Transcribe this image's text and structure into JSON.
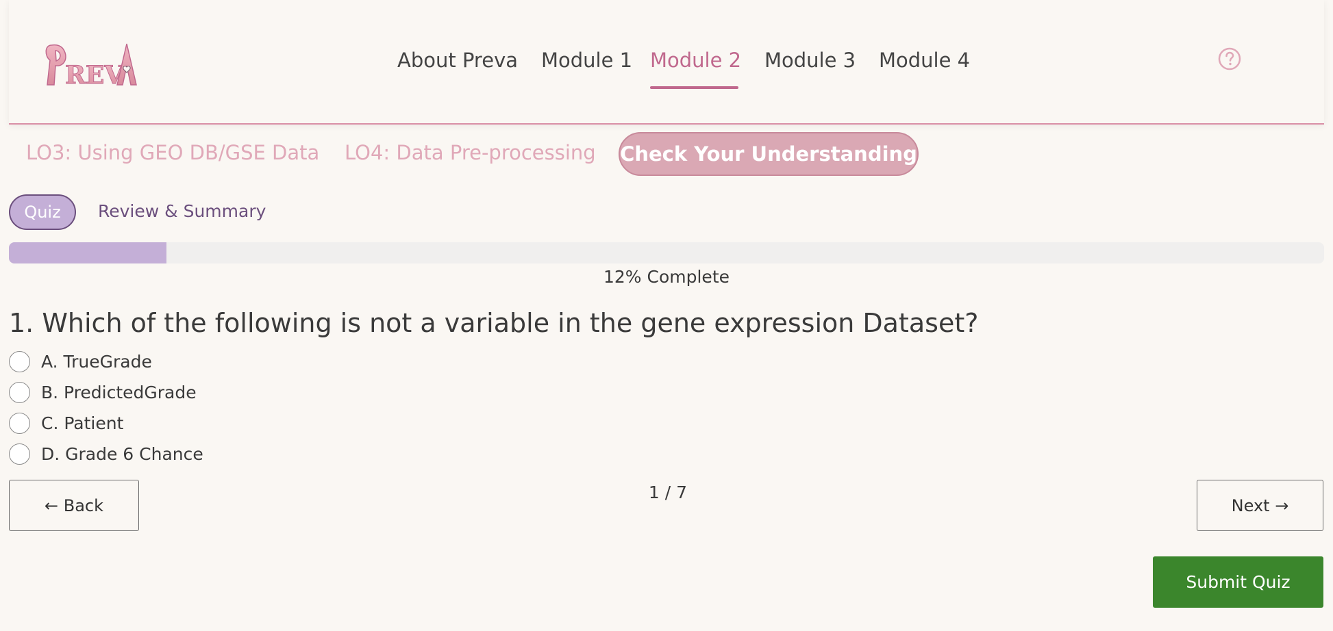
{
  "brand": {
    "logo_text": "PREVA",
    "accent_color": "#c0688d"
  },
  "nav": {
    "items": [
      {
        "label": "About Preva",
        "active": false
      },
      {
        "label": "Module 1",
        "active": false
      },
      {
        "label": "Module 2",
        "active": true
      },
      {
        "label": "Module 3",
        "active": false
      },
      {
        "label": "Module 4",
        "active": false
      }
    ],
    "help_icon": "question-circle-icon"
  },
  "lo_tabs": {
    "items": [
      {
        "label": "LO3: Using GEO DB/GSE Data"
      },
      {
        "label": "LO4: Data Pre-processing"
      }
    ],
    "active_label": "Check Your Understanding"
  },
  "sub_tabs": {
    "quiz_label": "Quiz",
    "review_label": "Review & Summary"
  },
  "progress": {
    "fraction": 0.12,
    "label": "12% Complete",
    "fill_color": "#c4afd7"
  },
  "question": {
    "text": "1. Which of the following is not a variable in the gene expression Dataset?",
    "options": [
      {
        "label": "A. TrueGrade"
      },
      {
        "label": "B. PredictedGrade"
      },
      {
        "label": "C. Patient"
      },
      {
        "label": "D. Grade 6 Chance"
      }
    ]
  },
  "pager": {
    "back_label": "← Back",
    "next_label": "Next →",
    "counter": "1 / 7"
  },
  "submit": {
    "label": "Submit Quiz",
    "color": "#3b862c"
  }
}
